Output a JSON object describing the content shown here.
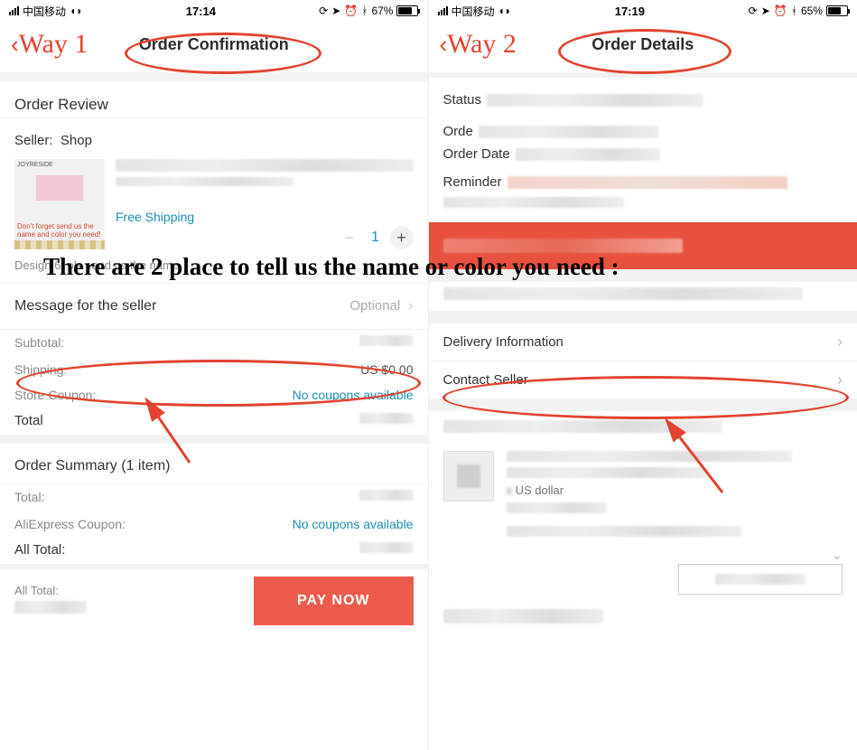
{
  "annotation": {
    "way1": "Way 1",
    "way2": "Way 2",
    "banner": "There are 2 place to tell us the name or color you need :"
  },
  "left": {
    "status": {
      "carrier": "中国移动",
      "time": "17:14",
      "battery": "67%"
    },
    "header_title": "Order Confirmation",
    "order_review": "Order Review",
    "seller_label": "Seller:",
    "seller_name": "Shop",
    "thumb_note": "Don't forget send us the name and color you need!",
    "thumb_tag": "JOYRESIDE",
    "free_shipping": "Free Shipping",
    "quantity": "1",
    "design_note": "Design 6, pls send us the name",
    "message_seller": "Message for the seller",
    "optional": "Optional",
    "subtotal_label": "Subtotal:",
    "shipping_label": "Shipping:",
    "shipping_value": "US $0.00",
    "store_coupon_label": "Store Coupon:",
    "no_coupons": "No coupons available",
    "total_label": "Total",
    "summary_title": "Order Summary (1 item)",
    "summary_total": "Total:",
    "ali_coupon": "AliExpress Coupon:",
    "all_total": "All Total:",
    "pay_now": "PAY NOW"
  },
  "right": {
    "status": {
      "carrier": "中国移动",
      "time": "17:19",
      "battery": "65%"
    },
    "header_title": "Order Details",
    "status_label": "Status",
    "order_label": "Orde",
    "order_date_label": "Order Date",
    "reminder_label": "Reminder",
    "delivery_info": "Delivery Information",
    "contact_seller": "Contact Seller",
    "currency_hint": "US dollar"
  }
}
